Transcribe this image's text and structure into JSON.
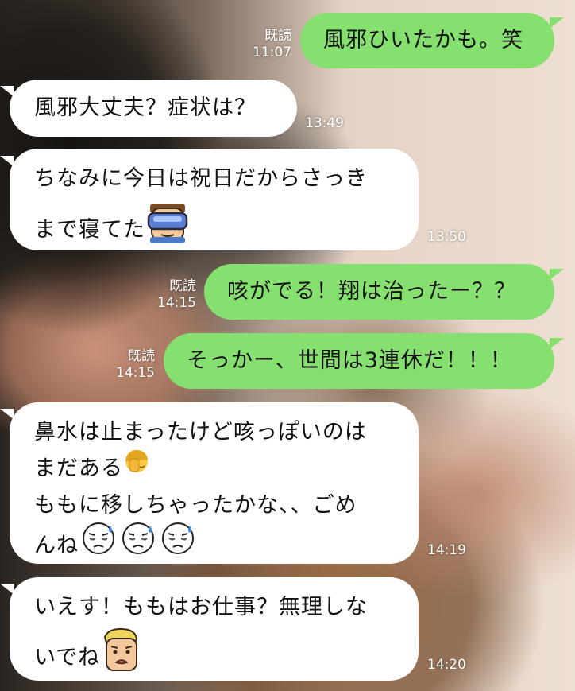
{
  "messages": [
    {
      "side": "sent",
      "text": "風邪ひいたかも。笑",
      "read": "既読",
      "time": "11:07"
    },
    {
      "side": "received",
      "text": "風邪大丈夫？症状は？",
      "time": "13:49"
    },
    {
      "side": "received",
      "line1": "ちなみに今日は祝日だからさっき",
      "line2": "まで寝てた",
      "time": "13:50",
      "emoji": "vr-goggles-face-sticker-icon"
    },
    {
      "side": "sent",
      "text": "咳がでる！翔は治ったー？？",
      "read": "既読",
      "time": "14:15"
    },
    {
      "side": "sent",
      "text": "そっかー、世間は3連休だ！！！",
      "read": "既読",
      "time": "14:15"
    },
    {
      "side": "received",
      "line1": "鼻水は止まったけど咳っぽいのは",
      "line2": "まだある",
      "line3": "ももに移しちゃったかな、、ごめ",
      "line4": "んね",
      "time": "14:19",
      "emoji": [
        "facepalm-emoji-icon",
        "sad-sweat-face-icon",
        "sad-sweat-face-icon",
        "sad-sweat-face-icon"
      ]
    },
    {
      "side": "received",
      "line1": "いえす！ももはお仕事？無理しな",
      "line2": "いでね",
      "time": "14:20",
      "emoji": "shocked-face-sticker-icon"
    }
  ],
  "colors": {
    "sent_bubble": "#86e06f",
    "received_bubble": "#ffffff",
    "timestamp_text": "#ffffff"
  }
}
